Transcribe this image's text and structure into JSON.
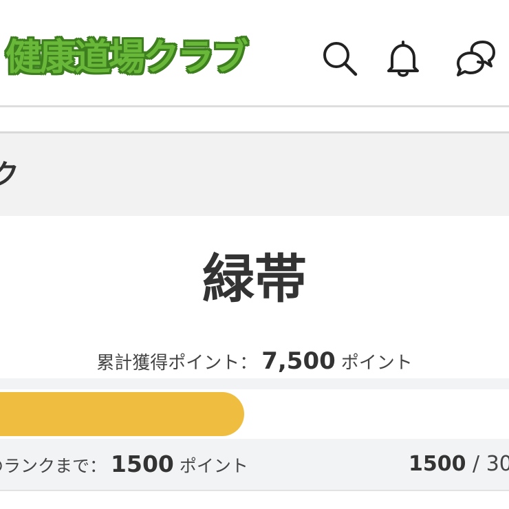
{
  "header": {
    "logo_text": "健康道場クラブ",
    "icons": [
      "search-icon",
      "bell-icon",
      "chat-icon"
    ]
  },
  "section": {
    "title_fragment": "ク"
  },
  "rank": {
    "name": "緑帯",
    "total_points_label": "累計獲得ポイント：",
    "total_points_value": "7,500",
    "total_points_unit": "ポイント"
  },
  "progress": {
    "next_rank_label": "のランクまで：",
    "next_rank_value": "1500",
    "next_rank_unit": "ポイント",
    "current": "1500",
    "separator": "/",
    "target_fragment": "30",
    "fill_fraction": 0.5,
    "fill_color": "#efbd3f"
  },
  "colors": {
    "brand_green": "#6ab83a",
    "brand_green_dark": "#3d7f1f",
    "text": "#333333"
  }
}
